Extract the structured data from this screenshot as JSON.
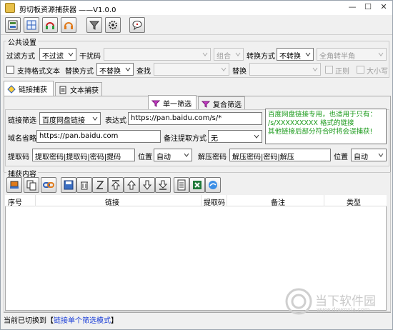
{
  "window": {
    "title": "剪切板资源捕获器 ——V1.0.0",
    "minimize": "—",
    "maximize": "☐",
    "close": "✕"
  },
  "toolbar": {
    "icons": [
      "settings-window-icon",
      "layout-icon",
      "headset-red-icon",
      "headset-orange-icon",
      "filter-icon",
      "gear-icon",
      "message-icon"
    ]
  },
  "public_settings": {
    "legend": "公共设置",
    "filter_mode_label": "过滤方式",
    "filter_mode_value": "不过滤",
    "noise_label": "干扰码",
    "noise_value": "",
    "combine_value": "组合",
    "convert_mode_label": "转换方式",
    "convert_mode_value": "不转换",
    "width_value": "全角转半角",
    "support_format_label": "支持格式文本",
    "replace_mode_label": "替换方式",
    "replace_mode_value": "不替换",
    "find_label": "查找",
    "find_value": "",
    "replace_label": "替换",
    "replace_value": "",
    "regex_label": "正则",
    "case_label": "大小写"
  },
  "tabs": {
    "link_capture": "链接捕获",
    "text_capture": "文本捕获"
  },
  "subtabs": {
    "single": "单一筛选",
    "compound": "复合筛选"
  },
  "link_filter": {
    "filter_label": "链接筛选",
    "filter_value": "百度网盘链接",
    "expr_label": "表达式",
    "expr_value": "https://pan.baidu.com/s/*",
    "domain_label": "域名省略",
    "domain_value": "https://pan.baidu.com",
    "remark_label": "备注提取方式",
    "remark_value": "无",
    "extract_label": "提取码",
    "extract_value": "提取密码|提取码|密码|提码",
    "position_label": "位置",
    "position_value": "自动",
    "unzip_label": "解压密码",
    "unzip_value": "解压密码|密码|解压",
    "position2_label": "位置",
    "position2_value": "自动",
    "note_lines": [
      "百度网盘链接专用，也适用于只有：",
      "/s/XXXXXXXXX 格式的链接",
      "其他链接后部分符合时将会误捕获!"
    ]
  },
  "capture": {
    "legend": "捕获内容",
    "columns": [
      "序号",
      "链接",
      "提取码",
      "备注",
      "类型"
    ]
  },
  "status": {
    "prefix": "当前已切换到【",
    "mode": "链接单个筛选模式",
    "suffix": "】"
  },
  "watermark": {
    "line1": "当下软件园",
    "line2": "www.downxia.com"
  }
}
